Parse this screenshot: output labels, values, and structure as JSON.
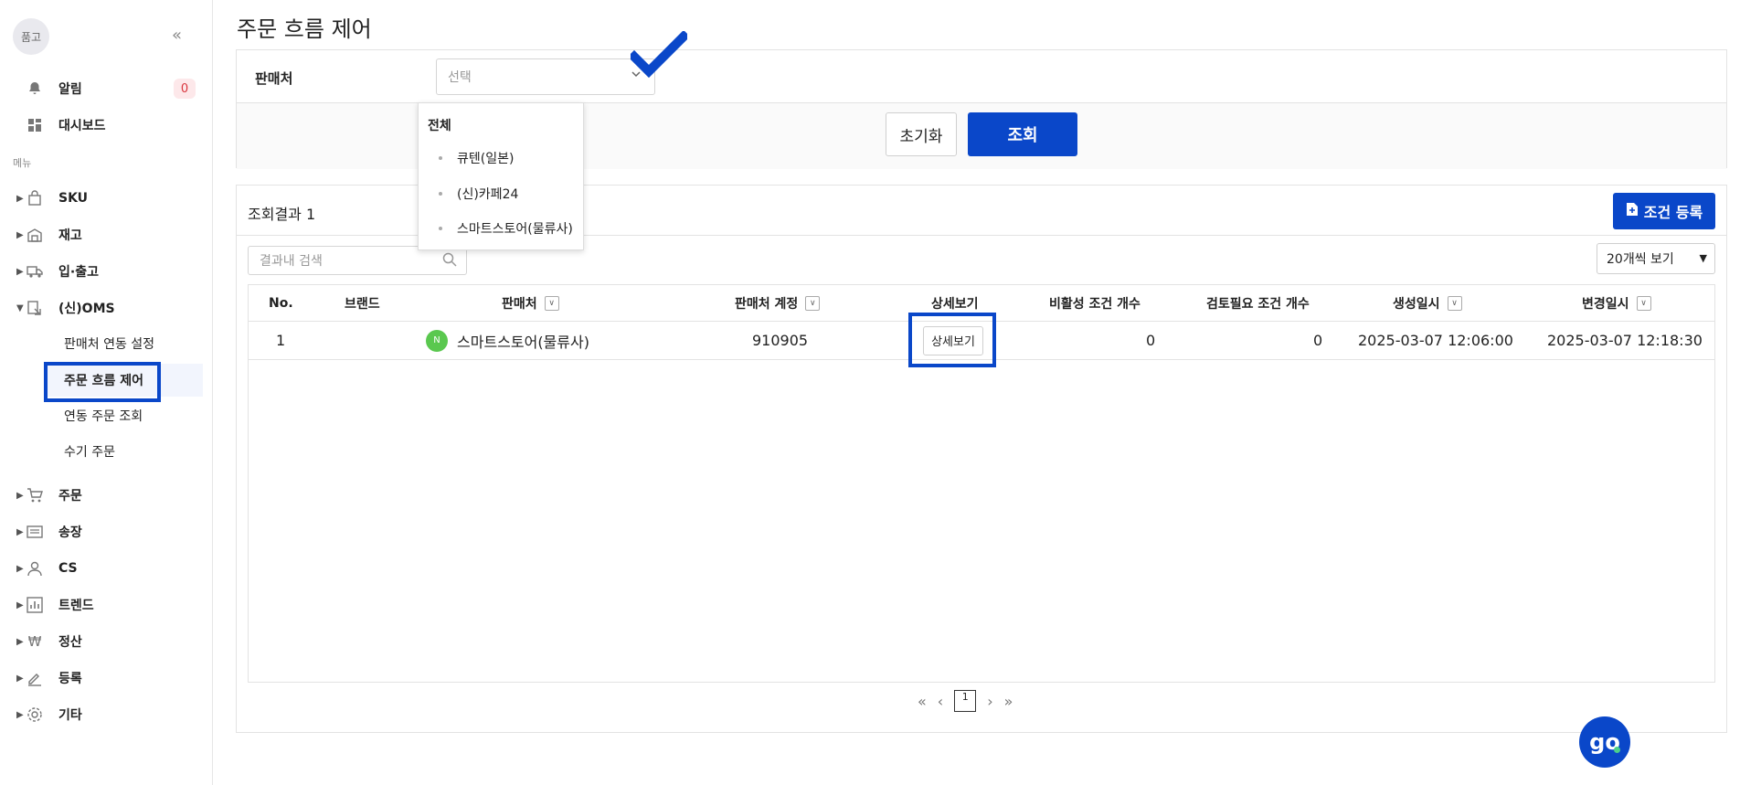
{
  "sidebar": {
    "avatar_text": "품고",
    "collapse_glyph": "«",
    "notifications": {
      "label": "알림",
      "count": "0"
    },
    "dashboard_label": "대시보드",
    "menu_section": "메뉴",
    "items": [
      {
        "label": "SKU"
      },
      {
        "label": "재고"
      },
      {
        "label": "입·출고"
      },
      {
        "label": "(신)OMS"
      }
    ],
    "oms_sub": [
      {
        "label": "판매처 연동 설정"
      },
      {
        "label": "주문 흐름 제어"
      },
      {
        "label": "연동 주문 조회"
      },
      {
        "label": "수기 주문"
      }
    ],
    "items2": [
      {
        "label": "주문"
      },
      {
        "label": "송장"
      },
      {
        "label": "CS"
      },
      {
        "label": "트렌드"
      },
      {
        "label": "정산"
      },
      {
        "label": "등록"
      },
      {
        "label": "기타"
      }
    ]
  },
  "page": {
    "title": "주문 흐름 제어"
  },
  "filter": {
    "seller_label": "판매처",
    "select_placeholder": "선택",
    "reset_label": "초기화",
    "search_label": "조회"
  },
  "dropdown": {
    "all_label": "전체",
    "options": [
      "큐텐(일본)",
      "(신)카페24",
      "스마트스토어(물류사)"
    ]
  },
  "results": {
    "count_label": "조회결과 1",
    "add_label": "조건 등록",
    "search_placeholder": "결과내 검색",
    "page_size": "20개씩 보기",
    "columns": [
      "No.",
      "브랜드",
      "판매처",
      "판매처 계정",
      "상세보기",
      "비활성 조건 개수",
      "검토필요 조건 개수",
      "생성일시",
      "변경일시"
    ],
    "rows": [
      {
        "no": "1",
        "brand": "",
        "seller": "스마트스토어(물류사)",
        "account": "910905",
        "detail_label": "상세보기",
        "inactive_count": "0",
        "review_count": "0",
        "created": "2025-03-07 12:06:00",
        "updated": "2025-03-07 12:18:30"
      }
    ]
  },
  "pager": {
    "first": "«",
    "prev": "‹",
    "current": "1",
    "next": "›",
    "last": "»"
  },
  "logo_text": "go",
  "colors": {
    "accent": "#0a47c9",
    "badge_bg": "#fde8ea",
    "badge_text": "#d9363e",
    "seller_icon": "#5ac84f"
  }
}
